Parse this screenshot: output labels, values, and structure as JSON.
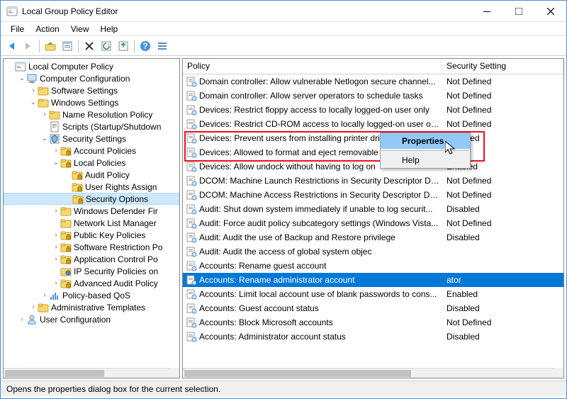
{
  "window": {
    "title": "Local Group Policy Editor"
  },
  "menus": [
    "File",
    "Action",
    "View",
    "Help"
  ],
  "status": "Opens the properties dialog box for the current selection.",
  "columns": {
    "policy": "Policy",
    "setting": "Security Setting"
  },
  "context_menu": {
    "properties": "Properties",
    "help": "Help"
  },
  "tree": [
    {
      "indent": 0,
      "toggle": "",
      "icon": "console",
      "label": "Local Computer Policy"
    },
    {
      "indent": 1,
      "toggle": "v",
      "icon": "computer",
      "label": "Computer Configuration"
    },
    {
      "indent": 2,
      "toggle": ">",
      "icon": "folder",
      "label": "Software Settings"
    },
    {
      "indent": 2,
      "toggle": "v",
      "icon": "folder",
      "label": "Windows Settings"
    },
    {
      "indent": 3,
      "toggle": ">",
      "icon": "folder",
      "label": "Name Resolution Policy"
    },
    {
      "indent": 3,
      "toggle": "",
      "icon": "script",
      "label": "Scripts (Startup/Shutdown"
    },
    {
      "indent": 3,
      "toggle": "v",
      "icon": "security",
      "label": "Security Settings"
    },
    {
      "indent": 4,
      "toggle": ">",
      "icon": "folder-lock",
      "label": "Account Policies"
    },
    {
      "indent": 4,
      "toggle": "v",
      "icon": "folder-lock",
      "label": "Local Policies"
    },
    {
      "indent": 5,
      "toggle": "",
      "icon": "folder-lock",
      "label": "Audit Policy"
    },
    {
      "indent": 5,
      "toggle": "",
      "icon": "folder-lock",
      "label": "User Rights Assign"
    },
    {
      "indent": 5,
      "toggle": "",
      "icon": "folder-lock",
      "label": "Security Options",
      "sel": true
    },
    {
      "indent": 4,
      "toggle": ">",
      "icon": "folder",
      "label": "Windows Defender Fir"
    },
    {
      "indent": 4,
      "toggle": "",
      "icon": "folder",
      "label": "Network List Manager"
    },
    {
      "indent": 4,
      "toggle": ">",
      "icon": "folder-lock",
      "label": "Public Key Policies"
    },
    {
      "indent": 4,
      "toggle": ">",
      "icon": "folder-lock",
      "label": "Software Restriction Po"
    },
    {
      "indent": 4,
      "toggle": ">",
      "icon": "folder-lock",
      "label": "Application Control Po"
    },
    {
      "indent": 4,
      "toggle": "",
      "icon": "ipsec",
      "label": "IP Security Policies on"
    },
    {
      "indent": 4,
      "toggle": ">",
      "icon": "folder-lock",
      "label": "Advanced Audit Policy"
    },
    {
      "indent": 3,
      "toggle": ">",
      "icon": "qos",
      "label": "Policy-based QoS"
    },
    {
      "indent": 2,
      "toggle": ">",
      "icon": "folder",
      "label": "Administrative Templates"
    },
    {
      "indent": 1,
      "toggle": ">",
      "icon": "user",
      "label": "User Configuration"
    }
  ],
  "policies": [
    {
      "name": "Accounts: Administrator account status",
      "setting": "Disabled"
    },
    {
      "name": "Accounts: Block Microsoft accounts",
      "setting": "Not Defined"
    },
    {
      "name": "Accounts: Guest account status",
      "setting": "Disabled"
    },
    {
      "name": "Accounts: Limit local account use of blank passwords to cons...",
      "setting": "Enabled"
    },
    {
      "name": "Accounts: Rename administrator account",
      "setting": "ator",
      "sel": true
    },
    {
      "name": "Accounts: Rename guest account",
      "setting": ""
    },
    {
      "name": "Audit: Audit the access of global system objec",
      "setting": ""
    },
    {
      "name": "Audit: Audit the use of Backup and Restore privilege",
      "setting": "Disabled"
    },
    {
      "name": "Audit: Force audit policy subcategory settings (Windows Vista...",
      "setting": "Not Defined"
    },
    {
      "name": "Audit: Shut down system immediately if unable to log securit...",
      "setting": "Disabled"
    },
    {
      "name": "DCOM: Machine Access Restrictions in Security Descriptor Defi...",
      "setting": "Not Defined"
    },
    {
      "name": "DCOM: Machine Launch Restrictions in Security Descriptor Def...",
      "setting": "Not Defined"
    },
    {
      "name": "Devices: Allow undock without having to log on",
      "setting": "Enabled"
    },
    {
      "name": "Devices: Allowed to format and eject removable media",
      "setting": ""
    },
    {
      "name": "Devices: Prevent users from installing printer drivers",
      "setting": "Disabled"
    },
    {
      "name": "Devices: Restrict CD-ROM access to locally logged-on user on...",
      "setting": "Not Defined"
    },
    {
      "name": "Devices: Restrict floppy access to locally logged-on user only",
      "setting": "Not Defined"
    },
    {
      "name": "Domain controller: Allow server operators to schedule tasks",
      "setting": "Not Defined"
    },
    {
      "name": "Domain controller: Allow vulnerable Netlogon secure channel...",
      "setting": "Not Defined"
    }
  ]
}
